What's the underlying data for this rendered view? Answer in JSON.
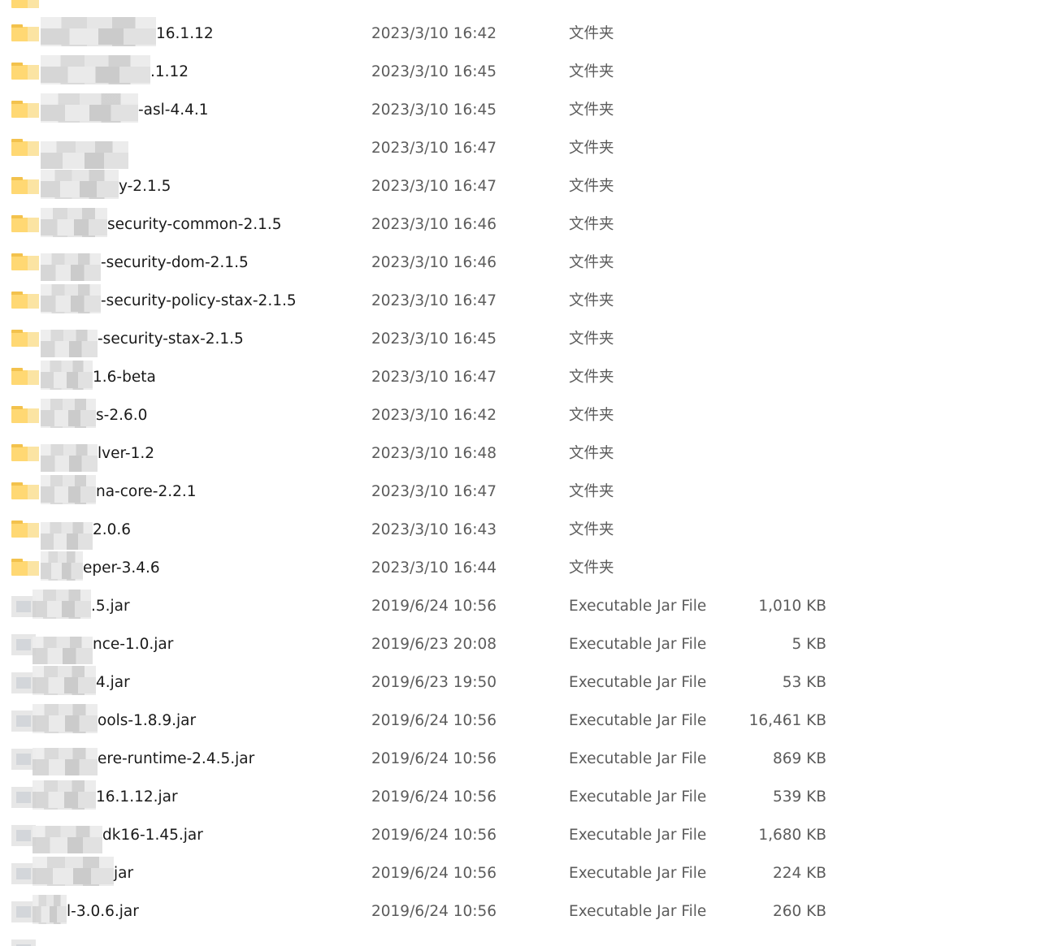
{
  "rows": [
    {
      "name": "16.1.12",
      "date": "2023/3/10 16:42",
      "type": "文件夹",
      "size": "",
      "kind": "folder"
    },
    {
      "name": ".1.12",
      "date": "2023/3/10 16:45",
      "type": "文件夹",
      "size": "",
      "kind": "folder"
    },
    {
      "name": "-asl-4.4.1",
      "date": "2023/3/10 16:45",
      "type": "文件夹",
      "size": "",
      "kind": "folder"
    },
    {
      "name": "",
      "date": "2023/3/10 16:47",
      "type": "文件夹",
      "size": "",
      "kind": "folder"
    },
    {
      "name": "y-2.1.5",
      "date": "2023/3/10 16:47",
      "type": "文件夹",
      "size": "",
      "kind": "folder"
    },
    {
      "name": "security-common-2.1.5",
      "date": "2023/3/10 16:46",
      "type": "文件夹",
      "size": "",
      "kind": "folder"
    },
    {
      "name": "-security-dom-2.1.5",
      "date": "2023/3/10 16:46",
      "type": "文件夹",
      "size": "",
      "kind": "folder"
    },
    {
      "name": "-security-policy-stax-2.1.5",
      "date": "2023/3/10 16:47",
      "type": "文件夹",
      "size": "",
      "kind": "folder"
    },
    {
      "name": "-security-stax-2.1.5",
      "date": "2023/3/10 16:45",
      "type": "文件夹",
      "size": "",
      "kind": "folder"
    },
    {
      "name": "1.6-beta",
      "date": "2023/3/10 16:47",
      "type": "文件夹",
      "size": "",
      "kind": "folder"
    },
    {
      "name": "s-2.6.0",
      "date": "2023/3/10 16:42",
      "type": "文件夹",
      "size": "",
      "kind": "folder"
    },
    {
      "name": "lver-1.2",
      "date": "2023/3/10 16:48",
      "type": "文件夹",
      "size": "",
      "kind": "folder"
    },
    {
      "name": "na-core-2.2.1",
      "date": "2023/3/10 16:47",
      "type": "文件夹",
      "size": "",
      "kind": "folder"
    },
    {
      "name": "2.0.6",
      "date": "2023/3/10 16:43",
      "type": "文件夹",
      "size": "",
      "kind": "folder"
    },
    {
      "name": "eper-3.4.6",
      "date": "2023/3/10 16:44",
      "type": "文件夹",
      "size": "",
      "kind": "folder"
    },
    {
      "name": ".5.jar",
      "date": "2019/6/24 10:56",
      "type": "Executable Jar File",
      "size": "1,010 KB",
      "kind": "jar"
    },
    {
      "name": "nce-1.0.jar",
      "date": "2019/6/23 20:08",
      "type": "Executable Jar File",
      "size": "5 KB",
      "kind": "jar"
    },
    {
      "name": "4.jar",
      "date": "2019/6/23 19:50",
      "type": "Executable Jar File",
      "size": "53 KB",
      "kind": "jar"
    },
    {
      "name": "ools-1.8.9.jar",
      "date": "2019/6/24 10:56",
      "type": "Executable Jar File",
      "size": "16,461 KB",
      "kind": "jar"
    },
    {
      "name": "ere-runtime-2.4.5.jar",
      "date": "2019/6/24 10:56",
      "type": "Executable Jar File",
      "size": "869 KB",
      "kind": "jar"
    },
    {
      "name": "16.1.12.jar",
      "date": "2019/6/24 10:56",
      "type": "Executable Jar File",
      "size": "539 KB",
      "kind": "jar"
    },
    {
      "name": "dk16-1.45.jar",
      "date": "2019/6/24 10:56",
      "type": "Executable Jar File",
      "size": "1,680 KB",
      "kind": "jar"
    },
    {
      "name": "jar",
      "date": "2019/6/24 10:56",
      "type": "Executable Jar File",
      "size": "224 KB",
      "kind": "jar"
    },
    {
      "name": "l-3.0.6.jar",
      "date": "2019/6/24 10:56",
      "type": "Executable Jar File",
      "size": "260 KB",
      "kind": "jar"
    }
  ]
}
